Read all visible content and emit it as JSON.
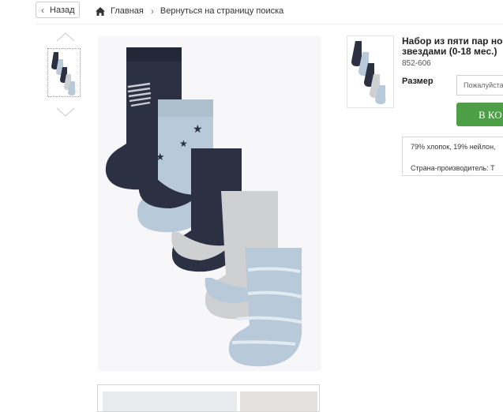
{
  "header": {
    "back_label": "Назад",
    "breadcrumbs": [
      "Главная",
      "Вернуться на страницу поиска"
    ]
  },
  "product": {
    "title_line1": "Набор из пяти пар но",
    "title_line2": "звездами (0-18 мес.)",
    "code": "852-606",
    "size_label": "Размер",
    "size_placeholder": "Пожалуйста,",
    "buy_label": "В КО",
    "composition": "79% хлопок, 19% нейлон,",
    "country": "Страна-производитель: Т"
  },
  "icons": [
    "home-icon",
    "chevron-left-icon",
    "chevron-right-icon",
    "chevron-up-icon",
    "chevron-down-icon"
  ],
  "colors": {
    "buy_button": "#4d9f46",
    "navy": "#2b3142",
    "light_blue": "#b8cad9",
    "grey": "#cfd0d2"
  }
}
